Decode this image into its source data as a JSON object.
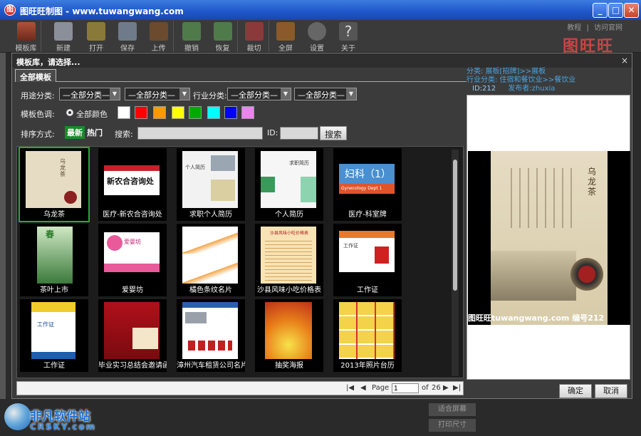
{
  "window": {
    "title": "图旺旺制图 - www.tuwangwang.com",
    "app_icon": "图",
    "controls": [
      "_",
      "□",
      "✕"
    ]
  },
  "toolbar": {
    "items": [
      {
        "label": "模板库",
        "icon": "template-library-icon"
      },
      {
        "label": "新建",
        "icon": "new-file-icon"
      },
      {
        "label": "打开",
        "icon": "folder-open-icon"
      },
      {
        "label": "保存",
        "icon": "save-icon"
      },
      {
        "label": "上传",
        "icon": "upload-icon"
      },
      {
        "label": "撤销",
        "icon": "undo-icon"
      },
      {
        "label": "恢复",
        "icon": "redo-icon"
      },
      {
        "label": "裁切",
        "icon": "scissors-icon"
      },
      {
        "label": "全屏",
        "icon": "fullscreen-icon"
      },
      {
        "label": "设置",
        "icon": "gear-icon"
      },
      {
        "label": "关于",
        "icon": "help-icon"
      }
    ],
    "links": [
      "教程",
      "|",
      "访问官网"
    ],
    "brand": "图旺旺"
  },
  "background": {
    "buttons": [
      "适合屏幕",
      "打印尺寸"
    ],
    "watermark_cn": "非凡软件站",
    "watermark_en": "CRSKY.com"
  },
  "dialog": {
    "title": "模板库，请选择...",
    "close": "×",
    "tab": "全部模板",
    "filters": {
      "usage_label": "用途分类:",
      "usage_value_1": "—全部分类—",
      "usage_value_2": "—全部分类—",
      "industry_label": "行业分类:",
      "industry_value_1": "—全部分类—",
      "industry_value_2": "—全部分类—",
      "color_label": "模板色调:",
      "color_all": "全部颜色",
      "colors": [
        "#ffffff",
        "#ff0000",
        "#ff9900",
        "#ffff00",
        "#00aa00",
        "#00ffff",
        "#0000ff",
        "#ee82ee"
      ],
      "sort_label": "排序方式:",
      "sort_new": "最新",
      "sort_hot": "热门",
      "search_label": "搜索:",
      "search_value": "",
      "id_label": "ID:",
      "id_value": "",
      "search_button": "搜索"
    },
    "templates": [
      {
        "name": "乌龙茶",
        "selected": true
      },
      {
        "name": "医疗-新农合咨询处",
        "thumb_text": "新农合咨询处"
      },
      {
        "name": "求职个人简历",
        "thumb_text": "个人简历"
      },
      {
        "name": "个人简历",
        "thumb_text": "求职简历"
      },
      {
        "name": "医疗-科室牌",
        "thumb_text": "妇科（1）",
        "thumb_sub": "Gynecology Dept 1"
      },
      {
        "name": "茶叶上市",
        "thumb_text": "春"
      },
      {
        "name": "爱婴坊",
        "thumb_text": "爱婴坊"
      },
      {
        "name": "橘色条纹名片"
      },
      {
        "name": "沙县风味小吃价格表",
        "thumb_text": "沙县风味小吃价格表"
      },
      {
        "name": "工作证",
        "thumb_text": "工作证"
      },
      {
        "name": "工作证",
        "thumb_text": "工作证"
      },
      {
        "name": "毕业实习总结会邀请函"
      },
      {
        "name": "漳州汽车租赁公司名片"
      },
      {
        "name": "抽奖海报"
      },
      {
        "name": "2013年照片台历"
      }
    ],
    "pager": {
      "page_label": "Page",
      "page": "1",
      "of_label": "of",
      "total": "26"
    },
    "info": {
      "category": "分类: 展板[招牌]>>展板",
      "industry": "行业分类: 住宿和餐饮业>>餐饮业",
      "id_line": "ID:212",
      "author": "发布者:zhuxia"
    },
    "preview": {
      "title_text": "乌龙茶",
      "watermark": "图旺旺tuwangwang.com 编号212"
    },
    "ok_button": "确定",
    "cancel_button": "取消"
  }
}
